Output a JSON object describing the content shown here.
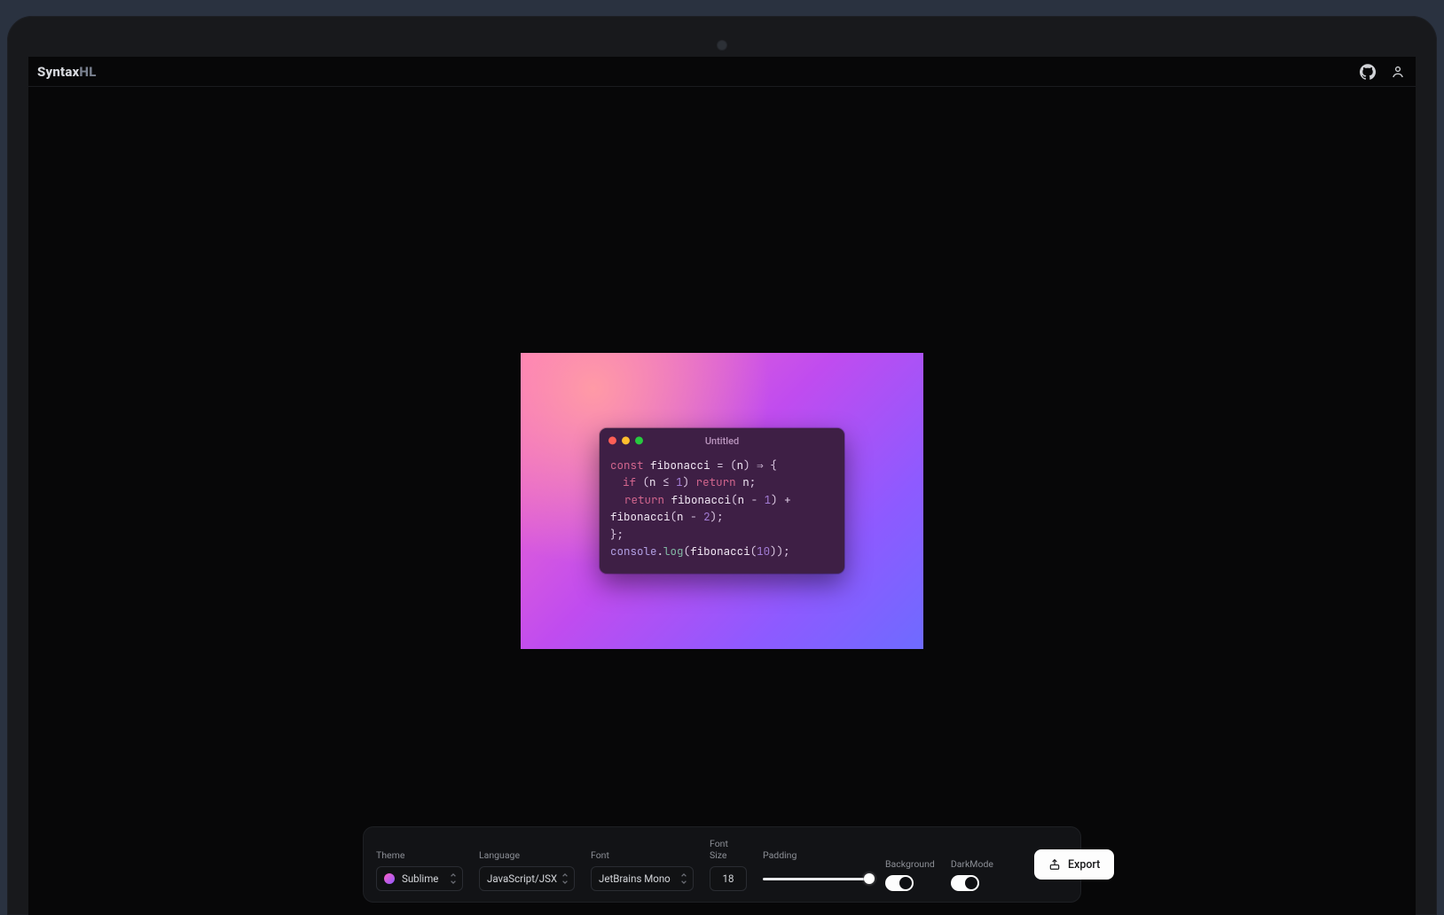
{
  "header": {
    "brand_main": "Syntax",
    "brand_accent": "HL"
  },
  "window": {
    "title": "Untitled"
  },
  "code": {
    "l1": {
      "kw": "const",
      "fn": "fibonacci",
      "eq": "=",
      "lp": "(",
      "arg": "n",
      "rp": ")",
      "arrow": "⇒",
      "lb": "{"
    },
    "l2": {
      "kw": "if",
      "lp": "(",
      "arg": "n",
      "op": "≤",
      "num": "1",
      "rp": ")",
      "ret": "return",
      "arg2": "n",
      "semi": ";"
    },
    "l3": {
      "ret": "return",
      "fn": "fibonacci",
      "lp": "(",
      "arg": "n",
      "minus": "-",
      "num": "1",
      "rp": ")",
      "plus": "+"
    },
    "l4": {
      "fn": "fibonacci",
      "lp": "(",
      "arg": "n",
      "minus": "-",
      "num": "2",
      "rp": ")",
      "semi": ";"
    },
    "l5": {
      "rb": "}",
      "semi": ";"
    },
    "l6": {
      "obj": "console",
      "dot": ".",
      "meth": "log",
      "lp": "(",
      "fn": "fibonacci",
      "lp2": "(",
      "num": "10",
      "rp2": ")",
      "rp": ")",
      "semi": ";"
    }
  },
  "controls": {
    "theme": {
      "label": "Theme",
      "value": "Sublime"
    },
    "language": {
      "label": "Language",
      "value": "JavaScript/JSX"
    },
    "font": {
      "label": "Font",
      "value": "JetBrains Mono"
    },
    "fontsize": {
      "label": "Font Size",
      "value": "18"
    },
    "padding": {
      "label": "Padding"
    },
    "background": {
      "label": "Background"
    },
    "darkmode": {
      "label": "DarkMode"
    },
    "export": {
      "label": "Export"
    }
  }
}
